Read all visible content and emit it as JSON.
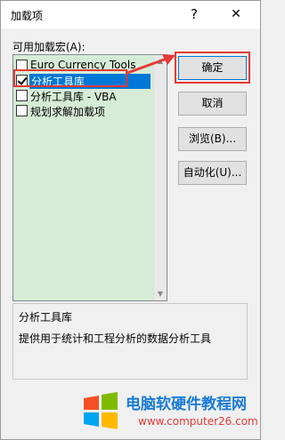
{
  "window": {
    "title": "加载项",
    "help_glyph": "?",
    "close_glyph": "✕"
  },
  "addins": {
    "list_label": "可用加载宏(A):",
    "items": [
      {
        "label": "Euro Currency Tools",
        "checked": false,
        "selected": false
      },
      {
        "label": "分析工具库",
        "checked": true,
        "selected": true
      },
      {
        "label": "分析工具库 - VBA",
        "checked": false,
        "selected": false
      },
      {
        "label": "规划求解加载项",
        "checked": false,
        "selected": false
      }
    ]
  },
  "buttons": {
    "ok": "确定",
    "cancel": "取消",
    "browse": "浏览(B)...",
    "automation": "自动化(U)..."
  },
  "details": {
    "title": "分析工具库",
    "description": "提供用于统计和工程分析的数据分析工具"
  },
  "watermark": {
    "title": "电脑软硬件教程网",
    "url": "www.computer26.com"
  },
  "colors": {
    "highlight": "#e53935",
    "selection": "#0078d7",
    "list_bg": "#d6ecd6"
  }
}
